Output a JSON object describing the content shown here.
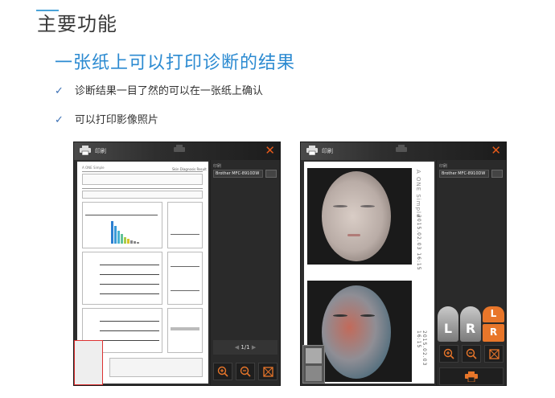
{
  "header": {
    "title": "主要功能",
    "subtitle": "一张纸上可以打印诊断的结果",
    "bullets": [
      "诊断结果一目了然的可以在一张纸上确认",
      "可以打印影像照片"
    ]
  },
  "window1": {
    "title_label": "印刷",
    "close_glyph": "✕",
    "printer_label": "印刷",
    "printer_name": "Brother MFC-8910DW",
    "pager": "1/1",
    "report_title": "A ONE Simple",
    "report_sub": "Skin Diagnosis Result",
    "icons": [
      "zoom-in-icon",
      "zoom-out-icon",
      "fit-icon"
    ]
  },
  "window2": {
    "title_label": "印刷",
    "close_glyph": "✕",
    "printer_label": "印刷",
    "printer_name": "Brother MFC-8910DW",
    "side_text": "A ONE Simple",
    "date_text_1": "2015.02.03 16:15",
    "date_text_2": "2015.02.03 16:15",
    "left_label": "L",
    "right_label": "R",
    "icons": [
      "zoom-in-icon",
      "zoom-out-icon",
      "fit-icon"
    ]
  },
  "colors": {
    "accent_blue": "#2b8ad1",
    "close_orange": "#e65a1a",
    "lr_orange": "#e8762a"
  }
}
